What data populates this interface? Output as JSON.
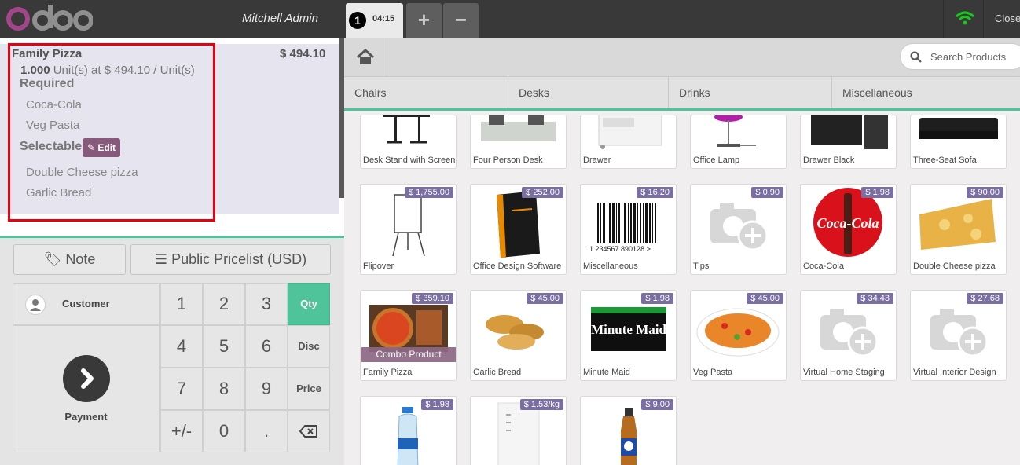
{
  "topbar": {
    "logo_text": "odoo",
    "user": "Mitchell Admin",
    "order_number": "1",
    "order_time": "04:15",
    "add_order_label": "+",
    "remove_order_label": "−",
    "close_label": "Close",
    "wifi_color": "#14c91a"
  },
  "order": {
    "line": {
      "name": "Family Pizza",
      "price": "$ 494.10",
      "qty": "1.000",
      "qty_detail": "Unit(s) at $ 494.10 / Unit(s)",
      "required_label": "Required",
      "required_items": [
        "Coca-Cola",
        "Veg Pasta"
      ],
      "selectable_label": "Selectable",
      "edit_label": "Edit",
      "selectable_items": [
        "Double Cheese pizza",
        "Garlic Bread"
      ]
    }
  },
  "controls": {
    "note_label": "Note",
    "pricelist_label": "Public Pricelist (USD)",
    "customer_label": "Customer",
    "payment_label": "Payment",
    "keys": [
      "1",
      "2",
      "3",
      "4",
      "5",
      "6",
      "7",
      "8",
      "9",
      "+/-",
      "0",
      "."
    ],
    "side_keys": [
      "Qty",
      "Disc",
      "Price"
    ]
  },
  "products_header": {
    "search_placeholder": "Search Products",
    "categories": [
      "Chairs",
      "Desks",
      "Drinks",
      "Miscellaneous"
    ]
  },
  "products": [
    {
      "name": "Desk Stand with Screen",
      "price": ""
    },
    {
      "name": "Four Person Desk",
      "price": ""
    },
    {
      "name": "Drawer",
      "price": ""
    },
    {
      "name": "Office Lamp",
      "price": ""
    },
    {
      "name": "Drawer Black",
      "price": ""
    },
    {
      "name": "Three-Seat Sofa",
      "price": ""
    },
    {
      "name": "Flipover",
      "price": "$ 1,755.00"
    },
    {
      "name": "Office Design Software",
      "price": "$ 252.00"
    },
    {
      "name": "Miscellaneous",
      "price": "$ 16.20"
    },
    {
      "name": "Tips",
      "price": "$ 0.90"
    },
    {
      "name": "Coca-Cola",
      "price": "$ 1.98"
    },
    {
      "name": "Double Cheese pizza",
      "price": "$ 90.00"
    },
    {
      "name": "Family Pizza",
      "price": "$ 359.10",
      "badge": "Combo Product"
    },
    {
      "name": "Garlic Bread",
      "price": "$ 45.00"
    },
    {
      "name": "Minute Maid",
      "price": "$ 1.98"
    },
    {
      "name": "Veg Pasta",
      "price": "$ 45.00"
    },
    {
      "name": "Virtual Home Staging",
      "price": "$ 34.43"
    },
    {
      "name": "Virtual Interior Design",
      "price": "$ 27.68"
    },
    {
      "name": "",
      "price": "$ 1.98"
    },
    {
      "name": "",
      "price": "$ 1.53/kg"
    },
    {
      "name": "",
      "price": "$ 9.00"
    }
  ],
  "image_text": {
    "barcode": "1 234567 890128 >",
    "coke": "Coca-Cola",
    "minute_maid": "Minute Maid"
  }
}
